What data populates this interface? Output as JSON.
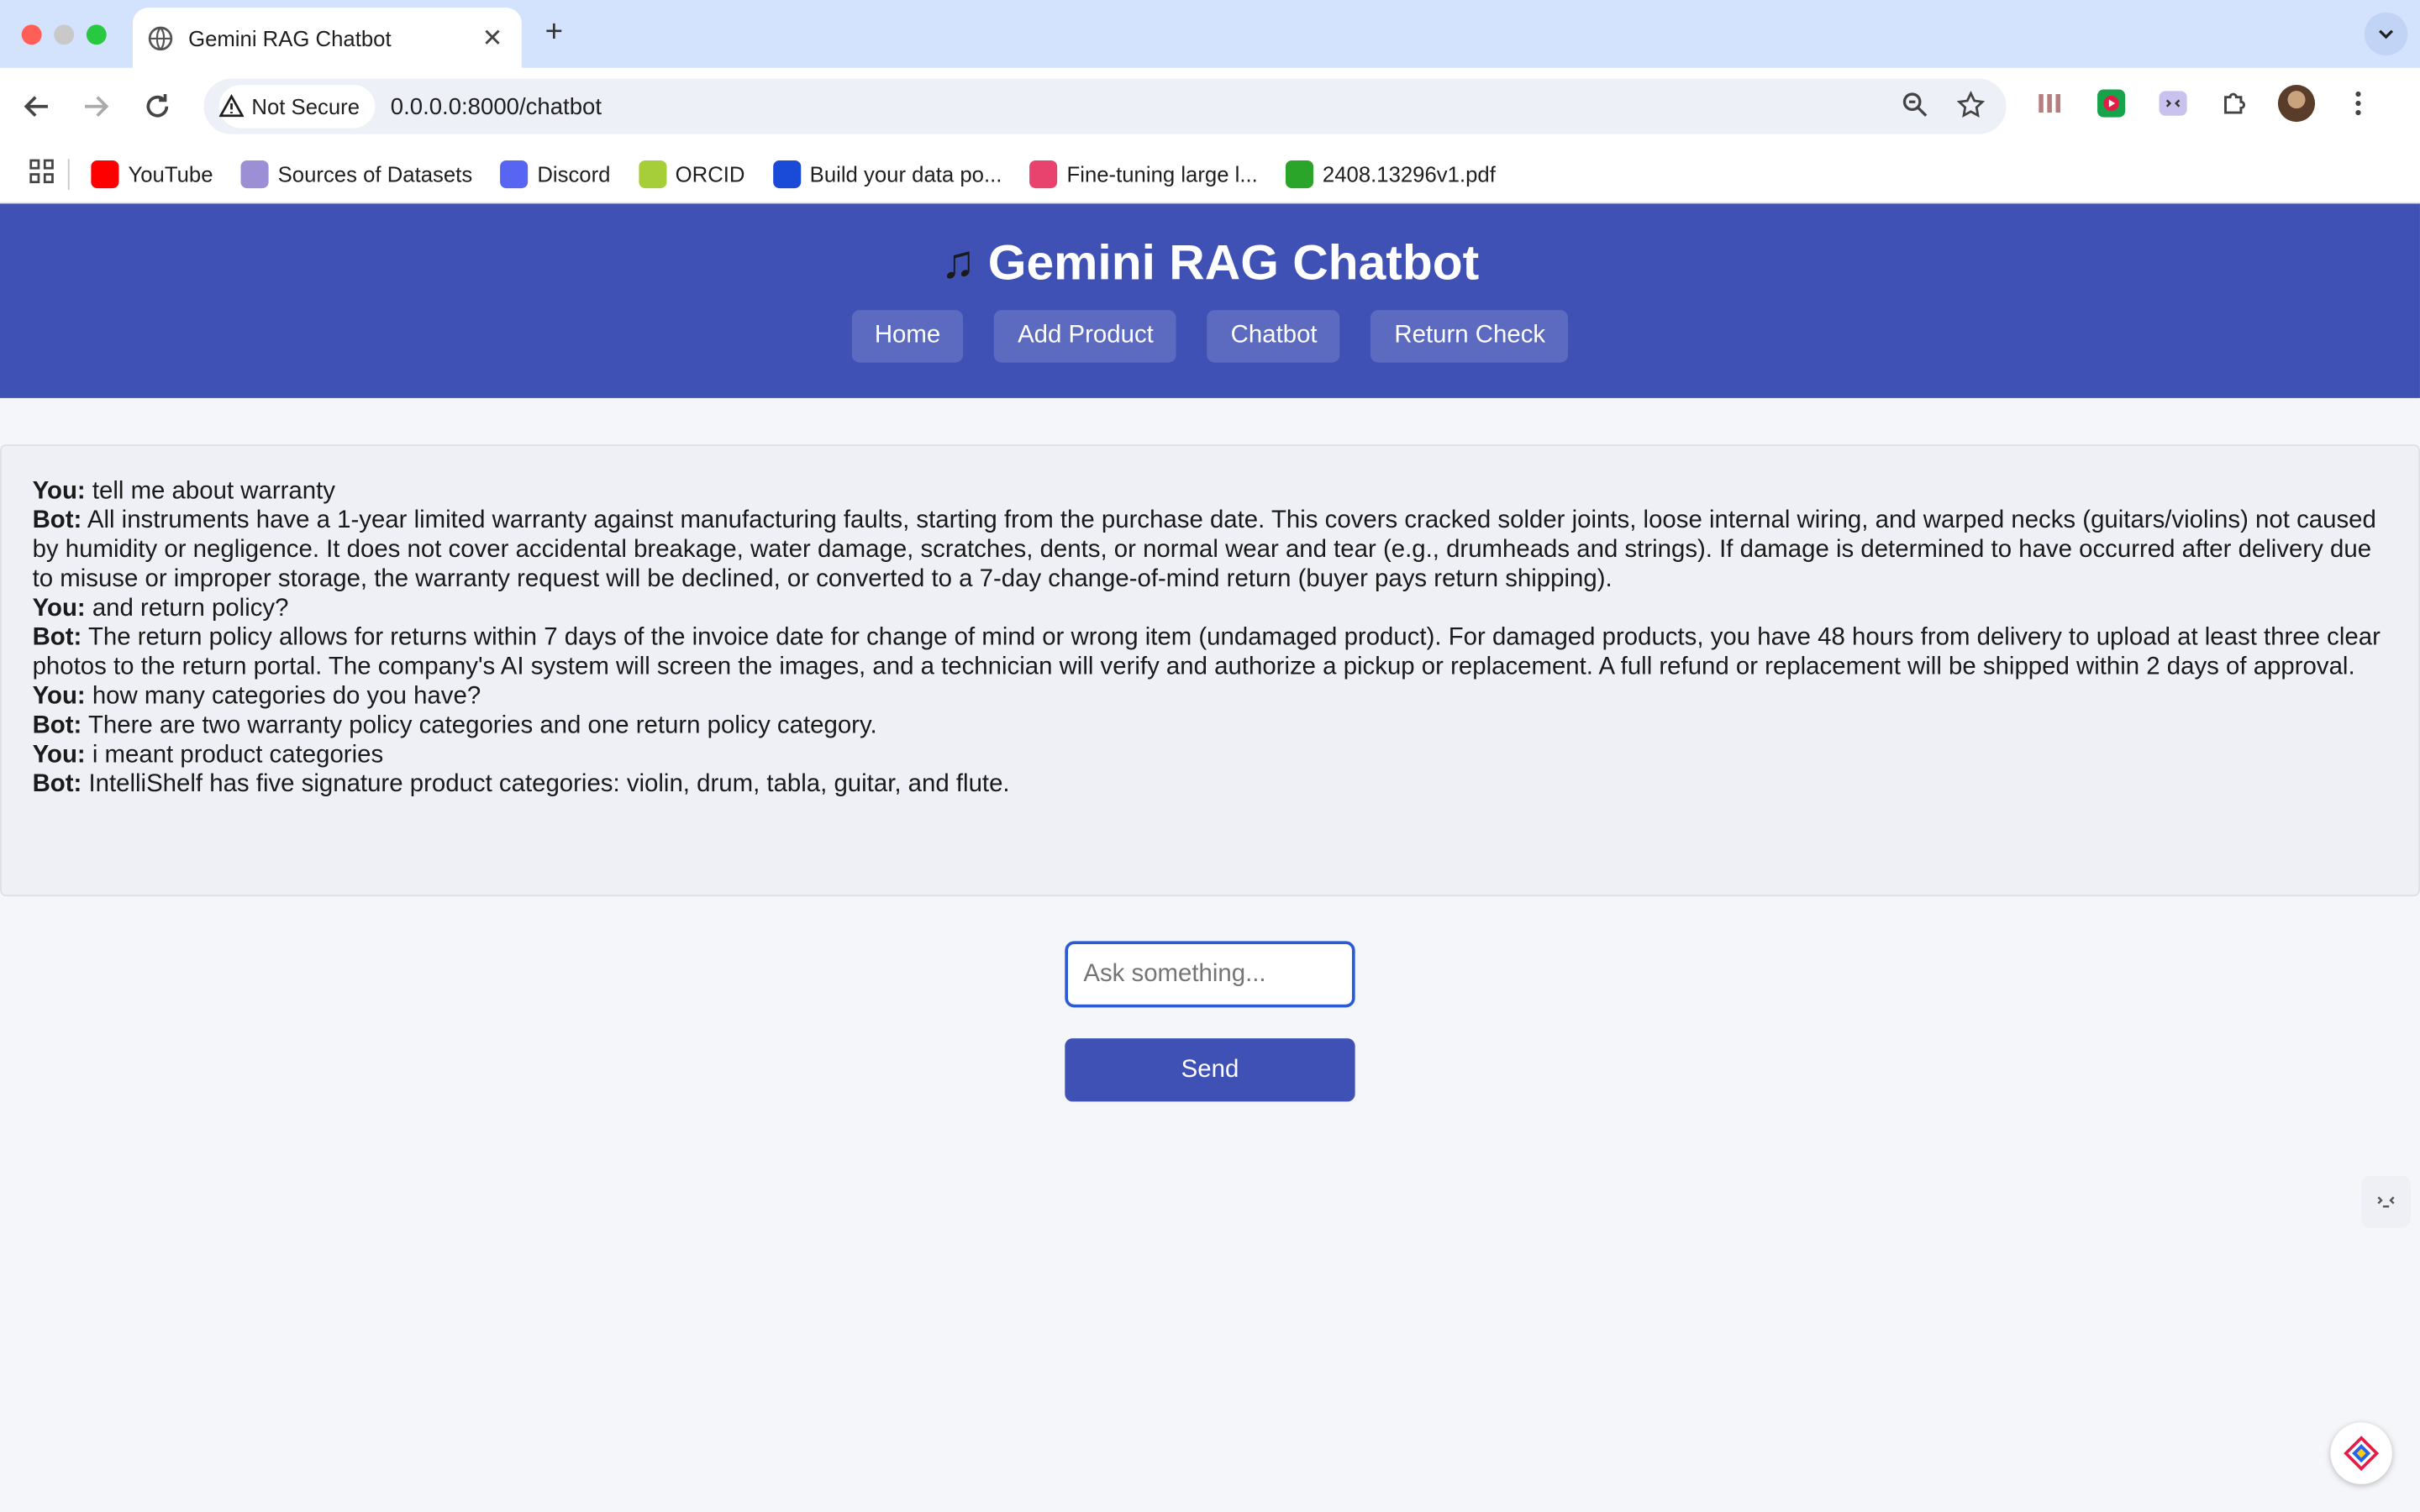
{
  "browser": {
    "tab_title": "Gemini RAG Chatbot",
    "security_label": "Not Secure",
    "url": "0.0.0.0:8000/chatbot",
    "bookmarks": [
      {
        "label": "YouTube",
        "icon": "youtube-icon",
        "color": "#ff0000"
      },
      {
        "label": "Sources of Datasets",
        "icon": "globe-icon",
        "color": "#9c8fd6"
      },
      {
        "label": "Discord",
        "icon": "discord-icon",
        "color": "#5865f2"
      },
      {
        "label": "ORCID",
        "icon": "orcid-icon",
        "color": "#a6ce39"
      },
      {
        "label": "Build your data po...",
        "icon": "d-icon",
        "color": "#1a4bd8"
      },
      {
        "label": "Fine-tuning large l...",
        "icon": "s-icon",
        "color": "#e8436f"
      },
      {
        "label": "2408.13296v1.pdf",
        "icon": "smiley-icon",
        "color": "#2aa52a"
      }
    ]
  },
  "page": {
    "title": "Gemini RAG Chatbot",
    "icon": "music-note-icon",
    "nav": [
      "Home",
      "Add Product",
      "Chatbot",
      "Return Check"
    ],
    "messages": [
      {
        "who": "You:",
        "text": " tell me about warranty"
      },
      {
        "who": "Bot:",
        "text": " All instruments have a 1-year limited warranty against manufacturing faults, starting from the purchase date. This covers cracked solder joints, loose internal wiring, and warped necks (guitars/violins) not caused by humidity or negligence. It does not cover accidental breakage, water damage, scratches, dents, or normal wear and tear (e.g., drumheads and strings). If damage is determined to have occurred after delivery due to misuse or improper storage, the warranty request will be declined, or converted to a 7-day change-of-mind return (buyer pays return shipping)."
      },
      {
        "who": "You:",
        "text": " and return policy?"
      },
      {
        "who": "Bot:",
        "text": " The return policy allows for returns within 7 days of the invoice date for change of mind or wrong item (undamaged product). For damaged products, you have 48 hours from delivery to upload at least three clear photos to the return portal. The company's AI system will screen the images, and a technician will verify and authorize a pickup or replacement. A full refund or replacement will be shipped within 2 days of approval."
      },
      {
        "who": "You:",
        "text": " how many categories do you have?"
      },
      {
        "who": "Bot:",
        "text": " There are two warranty policy categories and one return policy category."
      },
      {
        "who": "You:",
        "text": " i meant product categories"
      },
      {
        "who": "Bot:",
        "text": " IntelliShelf has five signature product categories: violin, drum, tabla, guitar, and flute."
      }
    ],
    "input_placeholder": "Ask something...",
    "send_label": "Send"
  },
  "colors": {
    "header": "#3f51b5",
    "nav_button": "#5c6bc0",
    "tabbar": "#d3e3fd"
  }
}
